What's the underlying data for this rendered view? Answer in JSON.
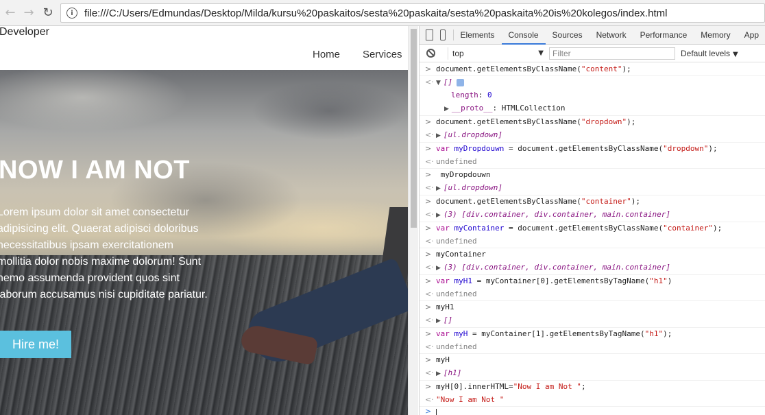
{
  "browser": {
    "back_icon": "←",
    "forward_icon": "→",
    "reload_icon": "↻",
    "info_icon": "i",
    "url": "file:///C:/Users/Edmundas/Desktop/Milda/kursu%20paskaitos/sesta%20paskaita/sesta%20paskaita%20is%20kolegos/index.html"
  },
  "site": {
    "brand": "Developer",
    "menu": [
      "Home",
      "Services"
    ],
    "hero_title": "NOW I AM NOT",
    "hero_text": "Lorem ipsum dolor sit amet consectetur adipisicing elit. Quaerat adipisci doloribus necessitatibus ipsam exercitationem mollitia dolor nobis maxime dolorum! Sunt nemo assumenda provident quos sint laborum accusamus nisi cupiditate pariatur.",
    "hire_button": "Hire me!",
    "hire_color": "#5bc0de"
  },
  "devtools": {
    "tabs": [
      "Elements",
      "Console",
      "Sources",
      "Network",
      "Performance",
      "Memory",
      "App"
    ],
    "active_tab": "Console",
    "context": "top",
    "filter_placeholder": "Filter",
    "levels": "Default levels",
    "log": {
      "l1": "document.getElementsByClassName(",
      "l1s": "\"content\"",
      "l1e": ");",
      "l2": "[]",
      "l2b": "length",
      "l2v": "0",
      "l2c": "__proto__",
      "l2d": "HTMLCollection",
      "l3": "document.getElementsByClassName(",
      "l3s": "\"dropdown\"",
      "l3e": ");",
      "l4": "[ul.dropdown]",
      "l5k": "var",
      "l5v": "myDropdouwn",
      "l5a": " = document.getElementsByClassName(",
      "l5s": "\"dropdown\"",
      "l5e": ");",
      "l6": "undefined",
      "l7": " myDropdouwn",
      "l8": "[ul.dropdown]",
      "l9": "document.getElementsByClassName(",
      "l9s": "\"container\"",
      "l9e": ");",
      "l10": "(3) [div.container, div.container, main.container]",
      "l11k": "var",
      "l11v": "myContainer",
      "l11a": " = document.getElementsByClassName(",
      "l11s": "\"container\"",
      "l11e": ");",
      "l12": "undefined",
      "l13": "myContainer",
      "l14": "(3) [div.container, div.container, main.container]",
      "l15k": "var",
      "l15v": "myH1",
      "l15a": " = myContainer[0].getElementsByTagName(",
      "l15s": "\"h1\"",
      "l15e": ")",
      "l16": "undefined",
      "l17": "myH1",
      "l18": "[]",
      "l19k": "var",
      "l19v": "myH",
      "l19a": " = myContainer[1].getElementsByTagName(",
      "l19s": "\"h1\"",
      "l19e": ");",
      "l20": "undefined",
      "l21": "myH",
      "l22": "[h1]",
      "l23a": "myH[0].innerHTML=",
      "l23s": "\"Now I am Not \"",
      "l23e": ";",
      "l24": "\"Now I am Not \""
    }
  }
}
